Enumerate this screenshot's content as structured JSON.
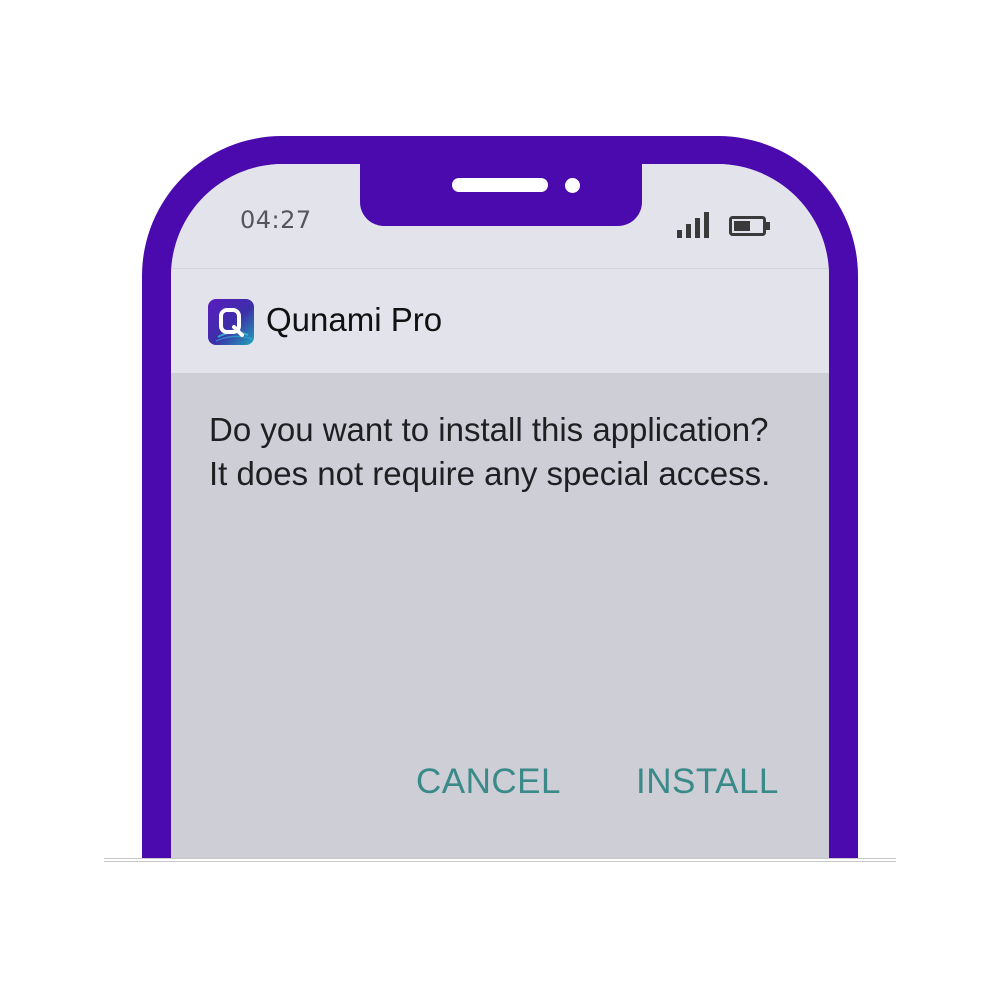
{
  "status_bar": {
    "time": "04:27",
    "signal_icon": "signal-bars-icon",
    "battery_icon": "battery-icon"
  },
  "app": {
    "icon": "qunami-app-icon",
    "name": "Qunami Pro"
  },
  "dialog": {
    "message": "Do you want to install this application?\nIt does not require any special access.",
    "cancel_label": "CANCEL",
    "install_label": "INSTALL"
  },
  "colors": {
    "phone_frame": "#4a0aae",
    "screen_background": "#cdced6",
    "header_background": "#e3e3ec",
    "button_text": "#3b8a8a"
  }
}
